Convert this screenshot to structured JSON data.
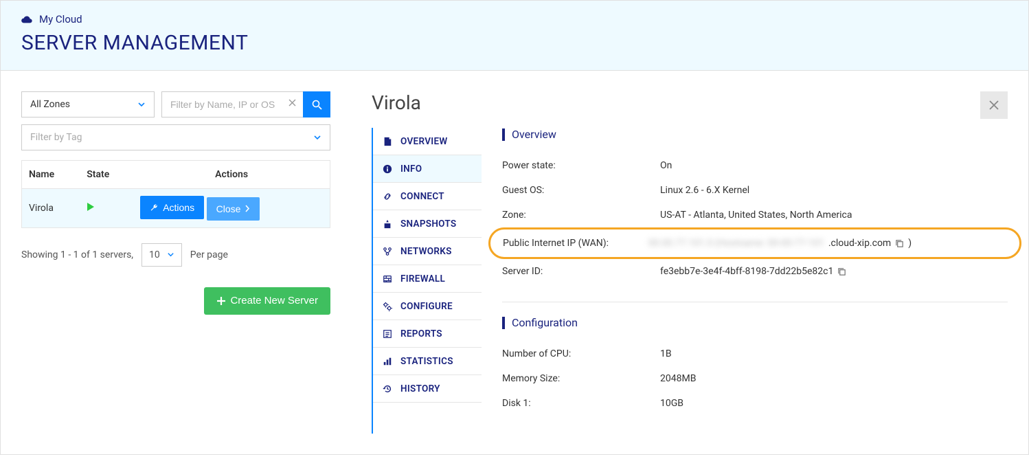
{
  "breadcrumb": {
    "label": "My Cloud"
  },
  "page_title": "SERVER MANAGEMENT",
  "filters": {
    "zone_label": "All Zones",
    "name_placeholder": "Filter by Name, IP or OS",
    "tag_placeholder": "Filter by Tag"
  },
  "table": {
    "headers": {
      "name": "Name",
      "state": "State",
      "actions": "Actions"
    },
    "rows": [
      {
        "name": "Virola"
      }
    ],
    "actions_btn": "Actions",
    "close_btn": "Close"
  },
  "pager": {
    "summary": "Showing 1 - 1 of 1 servers,",
    "page_size": "10",
    "per_page": "Per page"
  },
  "create_btn": "Create New Server",
  "server": {
    "title": "Virola",
    "nav": {
      "overview": "OVERVIEW",
      "info": "INFO",
      "connect": "CONNECT",
      "snapshots": "SNAPSHOTS",
      "networks": "NETWORKS",
      "firewall": "FIREWALL",
      "configure": "CONFIGURE",
      "reports": "REPORTS",
      "statistics": "STATISTICS",
      "history": "HISTORY"
    },
    "overview": {
      "heading": "Overview",
      "power_label": "Power state:",
      "power_value": "On",
      "os_label": "Guest OS:",
      "os_value": "Linux 2.6 - 6.X Kernel",
      "zone_label": "Zone:",
      "zone_value": "US-AT - Atlanta, United States, North America",
      "ip_label": "Public Internet IP (WAN):",
      "ip_hidden": "00.00.77.101.0 (Hostname: 00-00-77-101",
      "ip_suffix": ".cloud-xip.com",
      "ip_close": " )",
      "serverid_label": "Server ID:",
      "serverid_value": "fe3ebb7e-3e4f-4bff-8198-7dd22b5e82c1"
    },
    "config": {
      "heading": "Configuration",
      "cpu_label": "Number of CPU:",
      "cpu_value": "1B",
      "mem_label": "Memory Size:",
      "mem_value": "2048MB",
      "disk_label": "Disk 1:",
      "disk_value": "10GB"
    }
  }
}
